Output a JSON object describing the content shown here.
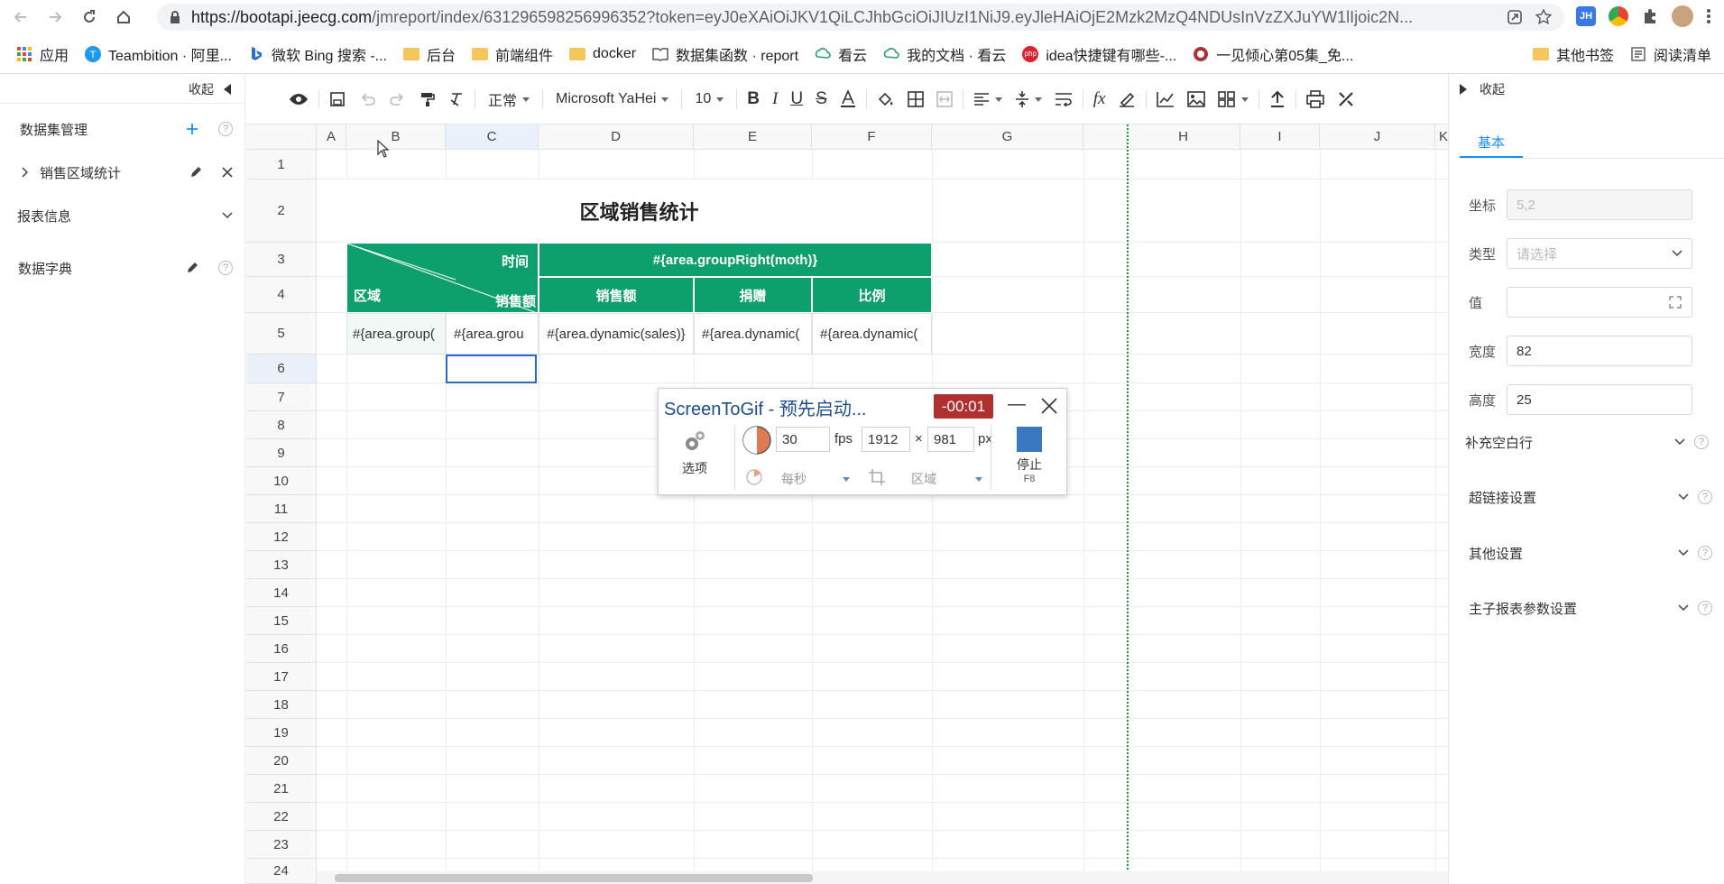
{
  "browser": {
    "url_host": "https://bootapi.jeecg.com",
    "url_path": "/jmreport/index/631296598256996352?token=eyJ0eXAiOiJKV1QiLCJhbGciOiJIUzI1NiJ9.eyJleHAiOjE2Mzk2MzQ4NDUsInVzZXJuYW1lIjoic2N...",
    "ext_jh": "JH"
  },
  "bookmarks": {
    "items": [
      {
        "label": "应用"
      },
      {
        "label": "Teambition · 阿里..."
      },
      {
        "label": "微软 Bing 搜索 -..."
      },
      {
        "label": "后台"
      },
      {
        "label": "前端组件"
      },
      {
        "label": "docker"
      },
      {
        "label": "数据集函数 · report"
      },
      {
        "label": "看云"
      },
      {
        "label": "我的文档 · 看云"
      },
      {
        "label": "idea快捷键有哪些-..."
      },
      {
        "label": "一见倾心第05集_免..."
      }
    ],
    "right": [
      {
        "label": "其他书签"
      },
      {
        "label": "阅读清单"
      }
    ],
    "php_badge": "php"
  },
  "left_panel": {
    "collapse": "收起",
    "dataset_mgmt": "数据集管理",
    "dataset_item": "销售区域统计",
    "report_info": "报表信息",
    "data_dict": "数据字典"
  },
  "toolbar": {
    "format": "正常",
    "font": "Microsoft YaHei",
    "size": "10",
    "fx": "fx"
  },
  "sheet": {
    "columns": [
      "A",
      "B",
      "C",
      "D",
      "E",
      "F",
      "G",
      "H",
      "I",
      "J",
      "K"
    ],
    "rows": [
      "1",
      "2",
      "3",
      "4",
      "5",
      "6",
      "7",
      "8",
      "9",
      "10",
      "11",
      "12",
      "13",
      "14",
      "15",
      "16",
      "17",
      "18",
      "19",
      "20",
      "21",
      "22",
      "23",
      "24"
    ],
    "title": "区域销售统计",
    "diag_time": "时间",
    "diag_area": "区域",
    "diag_amount": "销售额",
    "group_right": "#{area.groupRight(moth)}",
    "h_sales": "销售额",
    "h_donate": "捐赠",
    "h_ratio": "比例",
    "r5_b": "#{area.group(",
    "r5_c": "#{area.grou",
    "r5_d": "#{area.dynamic(sales)}",
    "r5_e": "#{area.dynamic(",
    "r5_f": "#{area.dynamic("
  },
  "right_panel": {
    "collapse": "收起",
    "tab_basic": "基本",
    "coord_label": "坐标",
    "coord_value": "5,2",
    "type_label": "类型",
    "type_placeholder": "请选择",
    "value_label": "值",
    "width_label": "宽度",
    "width_value": "82",
    "height_label": "高度",
    "height_value": "25",
    "sec_blank": "补充空白行",
    "sec_link": "超链接设置",
    "sec_other": "其他设置",
    "sec_sub": "主子报表参数设置"
  },
  "screentogif": {
    "title": "ScreenToGif - 预先启动...",
    "timer": "-00:01",
    "options": "选项",
    "fps_value": "30",
    "fps_unit": "fps",
    "width": "1912",
    "times": "×",
    "height": "981",
    "px": "px",
    "per_sec": "每秒",
    "region": "区域",
    "stop": "停止",
    "stop_key": "F8"
  },
  "colors": {
    "header_green": "#0ea06c",
    "accent_blue": "#1890ff",
    "selection_blue": "#2a69d3",
    "timer_red": "#b03030"
  }
}
